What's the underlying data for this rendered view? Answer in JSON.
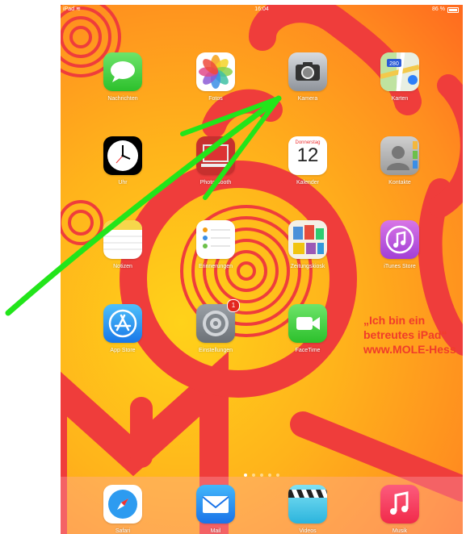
{
  "status": {
    "carrier": "iPad",
    "time": "16:04",
    "battery": "86 %"
  },
  "apps": [
    {
      "label": "Nachrichten",
      "icon": "messages-icon"
    },
    {
      "label": "Fotos",
      "icon": "photos-icon"
    },
    {
      "label": "Kamera",
      "icon": "camera-icon"
    },
    {
      "label": "Karten",
      "icon": "maps-icon",
      "sign": "280"
    },
    {
      "label": "Uhr",
      "icon": "clock-icon"
    },
    {
      "label": "Photo Booth",
      "icon": "photo-booth-icon"
    },
    {
      "label": "Kalender",
      "icon": "calendar-icon",
      "weekday": "Donnerstag",
      "day": "12"
    },
    {
      "label": "Kontakte",
      "icon": "contacts-icon"
    },
    {
      "label": "Notizen",
      "icon": "notes-icon"
    },
    {
      "label": "Erinnerungen",
      "icon": "reminders-icon"
    },
    {
      "label": "Zeitungskiosk",
      "icon": "newsstand-icon"
    },
    {
      "label": "iTunes Store",
      "icon": "itunes-store-icon"
    },
    {
      "label": "App Store",
      "icon": "app-store-icon"
    },
    {
      "label": "Einstellungen",
      "icon": "settings-icon",
      "badge": "1"
    },
    {
      "label": "FaceTime",
      "icon": "facetime-icon"
    }
  ],
  "dock": [
    {
      "label": "Safari",
      "icon": "safari-icon"
    },
    {
      "label": "Mail",
      "icon": "mail-icon"
    },
    {
      "label": "Videos",
      "icon": "videos-icon"
    },
    {
      "label": "Musik",
      "icon": "music-icon"
    }
  ],
  "wallpaper": {
    "lines": [
      "„Ich bin ein",
      "betreutes iPad“",
      "www.MOLE-Hess"
    ],
    "letters": "MOLE"
  },
  "colors": {
    "annotation_arrow": "#22e51a",
    "wall_red": "#ef3d3b",
    "wall_yellow": "#ffd21a"
  }
}
